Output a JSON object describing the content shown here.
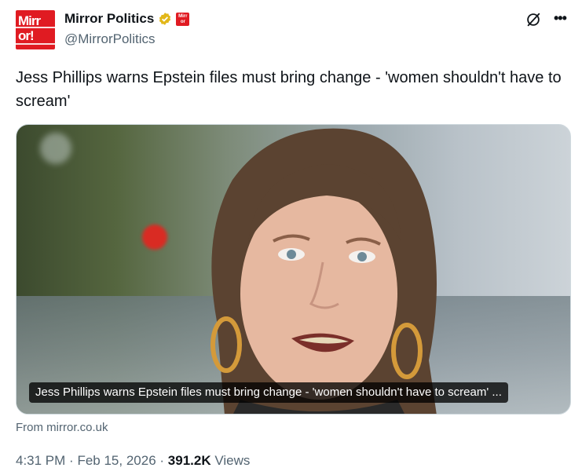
{
  "author": {
    "avatar_text_line1": "Mirr",
    "avatar_text_line2": "or!",
    "affiliate_badge_text": "Mirr or",
    "display_name": "Mirror Politics",
    "handle": "@MirrorPolitics"
  },
  "tweet": {
    "text": "Jess Phillips warns Epstein files must bring change - 'women shouldn't have to scream'"
  },
  "card": {
    "caption": "Jess Phillips warns Epstein files must bring change - 'women shouldn't have to scream' ...",
    "source": "From mirror.co.uk"
  },
  "meta": {
    "time": "4:31 PM",
    "separator": "·",
    "date": "Feb 15, 2026",
    "views_count": "391.2K",
    "views_label": "Views"
  },
  "colors": {
    "brand_red": "#e01b22",
    "verified_gold": "#e2b719",
    "secondary_text": "#536471"
  },
  "icons": [
    "verified-badge-icon",
    "grok-icon",
    "more-options-icon"
  ]
}
